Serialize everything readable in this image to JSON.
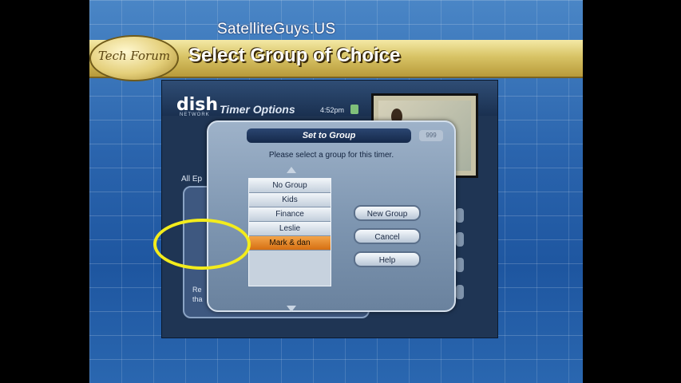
{
  "watermark": "SatelliteGuys.US",
  "banner": {
    "logo_text": "Tech Forum",
    "title": "Select Group of Choice"
  },
  "tv": {
    "brand": "dish",
    "brand_sub": "NETWORK",
    "screen_title": "Timer Options",
    "time": "4:52pm",
    "left_label": "All Ep",
    "left_bottom_1": "Re",
    "left_bottom_2": "tha"
  },
  "dialog": {
    "title": "Set to Group",
    "tag": "999",
    "instruction": "Please select a group for this timer.",
    "groups": [
      "No Group",
      "Kids",
      "Finance",
      "Leslie",
      "Mark & dan"
    ],
    "selected_index": 4,
    "buttons": {
      "new_group": "New Group",
      "cancel": "Cancel",
      "help": "Help"
    }
  },
  "colors": {
    "highlight_ring": "#f3ec1c",
    "selected_item": "#e07a18",
    "banner_gold": "#d8c466"
  }
}
